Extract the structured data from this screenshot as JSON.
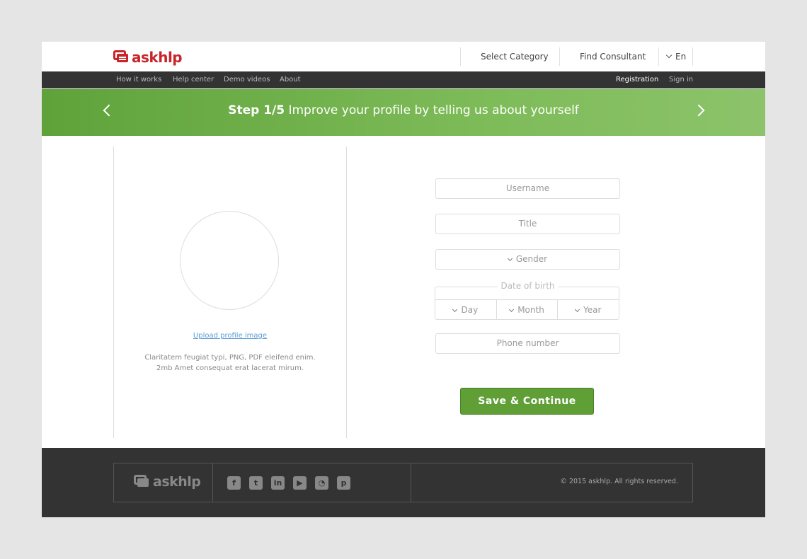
{
  "header": {
    "logo_text": "askhlp",
    "select_category": "Select Category",
    "find_consultant": "Find Consultant",
    "language": "En"
  },
  "subnav": {
    "how_it_works": "How it works",
    "help_center": "Help center",
    "demo_videos": "Demo videos",
    "about": "About",
    "registration": "Registration",
    "sign_in": "Sign in"
  },
  "banner": {
    "step": "Step 1/5",
    "message": "Improve your profile by telling us about yourself"
  },
  "profile": {
    "upload_link": "Upload profile image",
    "note_line1": "Claritatem feugiat  typi, PNG, PDF eleifend enim.",
    "note_line2": "2mb Amet consequat erat lacerat mirum."
  },
  "form": {
    "username_placeholder": "Username",
    "title_placeholder": "Title",
    "gender_label": "Gender",
    "dob_label": "Date of birth",
    "day_label": "Day",
    "month_label": "Month",
    "year_label": "Year",
    "phone_placeholder": "Phone number",
    "save_button": "Save & Continue"
  },
  "footer": {
    "logo_text": "askhlp",
    "social_icons": [
      "facebook-icon",
      "twitter-icon",
      "linkedin-icon",
      "youtube-icon",
      "rss-icon",
      "pinterest-icon"
    ],
    "copyright": "©  2015 askhlp. All rights reserved."
  },
  "colors": {
    "brand_red": "#c8252b",
    "banner_green": "#6db046",
    "button_green": "#5f9f36",
    "dark_bar": "#333333"
  }
}
